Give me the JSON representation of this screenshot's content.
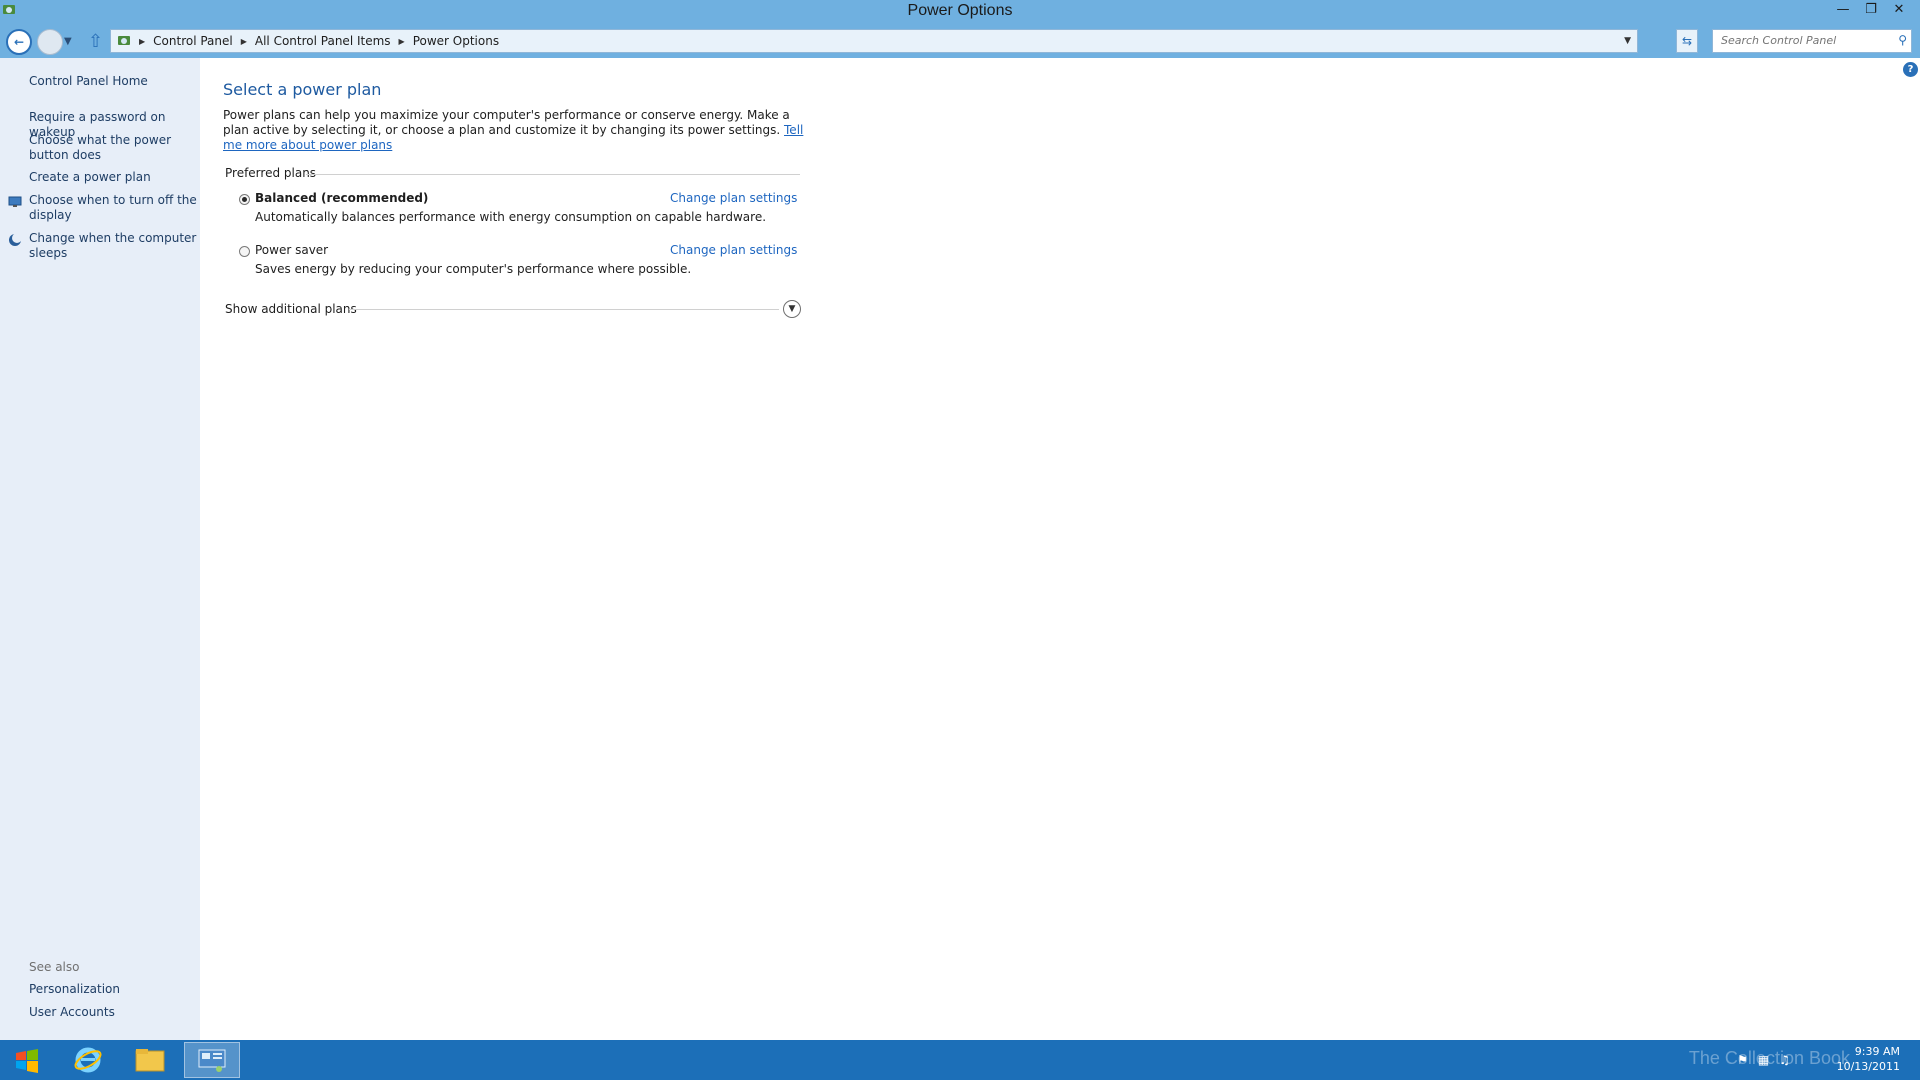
{
  "window": {
    "title": "Power Options"
  },
  "address": {
    "crumbs": [
      "Control Panel",
      "All Control Panel Items",
      "Power Options"
    ],
    "search_placeholder": "Search Control Panel"
  },
  "sidebar": {
    "home": "Control Panel Home",
    "items": [
      {
        "label": "Require a password on wakeup"
      },
      {
        "label": "Choose what the power button does"
      },
      {
        "label": "Create a power plan"
      },
      {
        "label": "Choose when to turn off the display"
      },
      {
        "label": "Change when the computer sleeps"
      }
    ],
    "see_also_label": "See also",
    "see_also": [
      "Personalization",
      "User Accounts"
    ]
  },
  "main": {
    "title": "Select a power plan",
    "intro": "Power plans can help you maximize your computer's performance or conserve energy. Make a plan active by selecting it, or choose a plan and customize it by changing its power settings.",
    "intro_link": "Tell me more about power plans",
    "preferred_label": "Preferred plans",
    "plans": [
      {
        "name": "Balanced (recommended)",
        "desc": "Automatically balances performance with energy consumption on capable hardware.",
        "link": "Change plan settings",
        "selected": true
      },
      {
        "name": "Power saver",
        "desc": "Saves energy by reducing your computer's performance where possible.",
        "link": "Change plan settings",
        "selected": false
      }
    ],
    "additional_label": "Show additional plans"
  },
  "taskbar": {
    "time": "9:39 AM",
    "date": "10/13/2011",
    "watermark": "The Collection Book"
  },
  "colors": {
    "titlebar": "#6fb0e0",
    "sidebar": "#e7eef8",
    "taskbar": "#1c6fb8",
    "link": "#1e66c0"
  }
}
